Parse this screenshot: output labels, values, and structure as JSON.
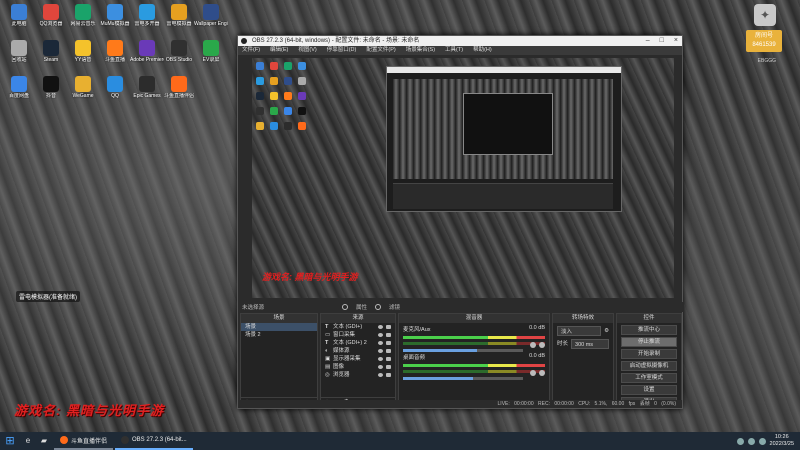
{
  "desktop": {
    "icons": [
      {
        "label": "此电脑",
        "color": "#3b7fd6"
      },
      {
        "label": "QQ浏览器",
        "color": "#e0463c"
      },
      {
        "label": "网易云音乐",
        "color": "#1aa36a"
      },
      {
        "label": "MuMu模拟器",
        "color": "#3c8fe0"
      },
      {
        "label": "雷电多开器",
        "color": "#2a9be0"
      },
      {
        "label": "雷电模拟器",
        "color": "#e6a020"
      },
      {
        "label": "Wallpaper Engine",
        "color": "#2f4d8a"
      },
      {
        "label": "回收站",
        "color": "#aaaaaa"
      },
      {
        "label": "Steam",
        "color": "#1b2838"
      },
      {
        "label": "YY语音",
        "color": "#f4c22b"
      },
      {
        "label": "斗鱼直播",
        "color": "#ff7a1a"
      },
      {
        "label": "Adobe Premiere",
        "color": "#6a3ab8"
      },
      {
        "label": "OBS Studio",
        "color": "#303030"
      },
      {
        "label": "EV录屏",
        "color": "#2aa84a"
      },
      {
        "label": "百度网盘",
        "color": "#3b86e8"
      },
      {
        "label": "抖音",
        "color": "#111111"
      },
      {
        "label": "WeGame",
        "color": "#e8b030"
      },
      {
        "label": "QQ",
        "color": "#2a8de0"
      },
      {
        "label": "Epic Games",
        "color": "#2c2c2c"
      },
      {
        "label": "斗鱼直播伴侣",
        "color": "#ff6a1a"
      }
    ]
  },
  "badge": {
    "text": "房间号",
    "number": "8461539",
    "sub": "EBGGG"
  },
  "obs": {
    "title": "OBS 27.2.3 (64-bit, windows) - 配置文件: 未命名 - 场景: 未命名",
    "menu": [
      "文件(F)",
      "编辑(E)",
      "视图(V)",
      "停靠窗口(D)",
      "配置文件(P)",
      "场景集合(S)",
      "工具(T)",
      "帮助(H)"
    ],
    "preview_caption": "游戏名: 黑暗与光明手游",
    "source_toolbar": {
      "properties": "属性",
      "filters": "滤镜",
      "none": "未选择源"
    },
    "scenes": {
      "header": "场景",
      "items": [
        "场景",
        "场景 2"
      ],
      "selected": 0
    },
    "sources": {
      "header": "来源",
      "items": [
        {
          "icon": "T",
          "name": "文本 (GDI+)"
        },
        {
          "icon": "▭",
          "name": "窗口采集"
        },
        {
          "icon": "T",
          "name": "文本 (GDI+) 2"
        },
        {
          "icon": "◐",
          "name": "媒体源"
        },
        {
          "icon": "▣",
          "name": "显示器采集"
        },
        {
          "icon": "▤",
          "name": "图像"
        },
        {
          "icon": "◎",
          "name": "浏览器"
        }
      ]
    },
    "mixer": {
      "header": "混音器",
      "tracks": [
        {
          "name": "麦克风/Aux",
          "db": "0.0 dB",
          "level": 0.62
        },
        {
          "name": "桌面音频",
          "db": "0.0 dB",
          "level": 0.58
        }
      ]
    },
    "transitions": {
      "header": "转场特效",
      "type": "淡入",
      "duration_label": "时长",
      "duration": "300 ms"
    },
    "controls": {
      "header": "控件",
      "buttons": [
        "推流中心",
        "停止推流",
        "开始录制",
        "启动虚拟摄像机",
        "工作室模式",
        "设置",
        "退出"
      ],
      "highlighted": 1
    },
    "status": {
      "live": "LIVE: 00:00:00",
      "rec": "REC: 00:00:00",
      "cpu": "CPU: 5.1%, 60.00 fps",
      "drops": "丢帧 0 (0.0%)"
    }
  },
  "bottom_caption": "游戏名: 黑暗与光明手游",
  "desktop_note": "雷电模拟器(准备就绪)",
  "taskbar": {
    "tasks": [
      {
        "label": "斗鱼直播伴侣",
        "color": "#ff6a1a",
        "active": false
      },
      {
        "label": "OBS 27.2.3 (64-bit...",
        "color": "#303030",
        "active": true
      }
    ],
    "time": "10:26",
    "date": "2022/3/25"
  }
}
